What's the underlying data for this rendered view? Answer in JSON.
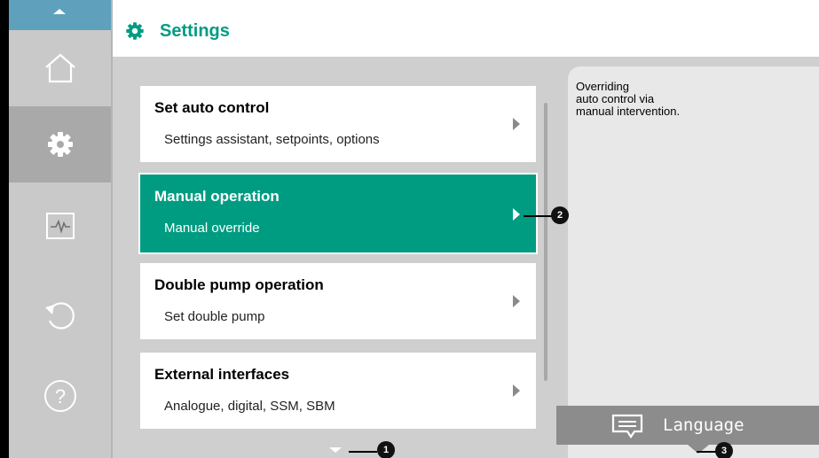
{
  "header": {
    "title": "Settings"
  },
  "sidebar": {
    "items": [
      {
        "icon": "home-icon"
      },
      {
        "icon": "gear-icon"
      },
      {
        "icon": "diagnostics-icon"
      },
      {
        "icon": "undo-icon"
      },
      {
        "icon": "help-icon"
      }
    ]
  },
  "menu": [
    {
      "title": "Set auto control",
      "subtitle": "Settings assistant, setpoints, options"
    },
    {
      "title": "Manual operation",
      "subtitle": "Manual override"
    },
    {
      "title": "Double pump operation",
      "subtitle": "Set double pump"
    },
    {
      "title": "External interfaces",
      "subtitle": "Analogue, digital, SSM, SBM"
    }
  ],
  "info": {
    "line1": "Overriding",
    "line2": "auto control via",
    "line3": "manual intervention."
  },
  "language_button": {
    "label": "Language"
  },
  "callouts": {
    "c1": "1",
    "c2": "2",
    "c3": "3"
  },
  "colors": {
    "accent": "#009c82",
    "sidebar_top": "#5fa0bd"
  }
}
